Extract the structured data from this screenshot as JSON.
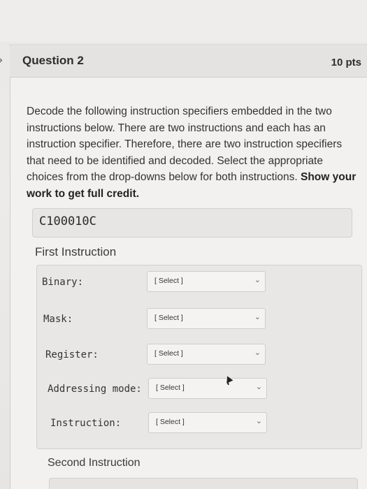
{
  "question": {
    "title": "Question 2",
    "points": "10 pts",
    "prompt_plain": "Decode the following instruction specifiers embedded in the two instructions below. There are two instructions and each has an instruction specifier. Therefore, there are two instruction specifiers that need to be identified and decoded. Select the appropriate choices from the drop-downs below for both instructions. ",
    "prompt_bold": "Show your work to get full credit.",
    "code": "C100010C"
  },
  "first_instruction": {
    "heading": "First Instruction",
    "fields": [
      {
        "label": "Binary:",
        "selected": "[ Select ]"
      },
      {
        "label": "Mask:",
        "selected": "[ Select ]"
      },
      {
        "label": "Register:",
        "selected": "[ Select ]"
      },
      {
        "label": "Addressing mode:",
        "selected": "[ Select ]"
      },
      {
        "label": "Instruction:",
        "selected": "[ Select ]"
      }
    ]
  },
  "second_instruction": {
    "heading": "Second Instruction"
  },
  "icons": {
    "collapse": "chevron-right-icon",
    "dropdown": "chevron-down-icon"
  },
  "colors": {
    "background": "#e9e8e6",
    "card": "#f2f1ef",
    "border": "#cfcdca",
    "text": "#333333"
  }
}
